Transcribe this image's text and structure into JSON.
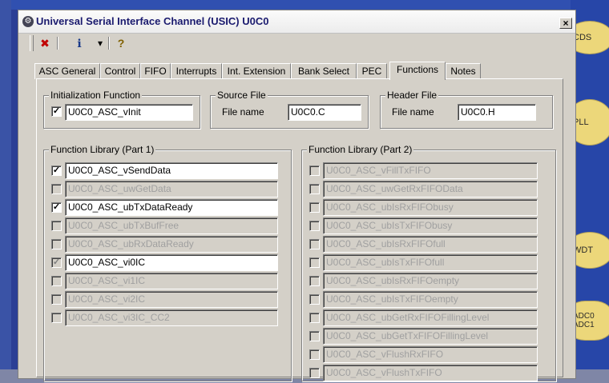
{
  "window": {
    "title": "Universal Serial Interface Channel (USIC) U0C0",
    "close_symbol": "×"
  },
  "toolbar": {
    "buttons": [
      {
        "icon": "close-document-icon",
        "glyph": "✖"
      },
      {
        "icon": "info-book-icon",
        "glyph": "ℹ"
      },
      {
        "icon": "dropdown-arrow-icon",
        "glyph": "▾"
      },
      {
        "icon": "help-icon",
        "glyph": "?"
      }
    ]
  },
  "tabs": [
    {
      "label": "ASC General"
    },
    {
      "label": "Control"
    },
    {
      "label": "FIFO"
    },
    {
      "label": "Interrupts"
    },
    {
      "label": "Int. Extension"
    },
    {
      "label": "Bank Select"
    },
    {
      "label": "PEC"
    },
    {
      "label": "Functions",
      "active": true
    },
    {
      "label": "Notes"
    }
  ],
  "init_group": {
    "label": "Initialization Function",
    "checked": true,
    "check_glyph": "✓",
    "value": "U0C0_ASC_vInit"
  },
  "source_group": {
    "label": "Source File",
    "field_label": "File name",
    "value": "U0C0.C"
  },
  "header_group": {
    "label": "Header File",
    "field_label": "File name",
    "value": "U0C0.H"
  },
  "lib1": {
    "label": "Function Library (Part 1)",
    "items": [
      {
        "name": "U0C0_ASC_vSendData",
        "checked": true,
        "enabled": true
      },
      {
        "name": "U0C0_ASC_uwGetData",
        "checked": false,
        "enabled": false
      },
      {
        "name": "U0C0_ASC_ubTxDataReady",
        "checked": true,
        "enabled": true
      },
      {
        "name": "U0C0_ASC_ubTxBufFree",
        "checked": false,
        "enabled": false
      },
      {
        "name": "U0C0_ASC_ubRxDataReady",
        "checked": false,
        "enabled": false
      },
      {
        "name": "U0C0_ASC_vi0IC",
        "checked": true,
        "enabled": true,
        "checkbox_disabled": true
      },
      {
        "name": "U0C0_ASC_vi1IC",
        "checked": false,
        "enabled": false
      },
      {
        "name": "U0C0_ASC_vi2IC",
        "checked": false,
        "enabled": false
      },
      {
        "name": "U0C0_ASC_vi3IC_CC2",
        "checked": false,
        "enabled": false
      }
    ]
  },
  "lib2": {
    "label": "Function Library (Part 2)",
    "items": [
      {
        "name": "U0C0_ASC_vFillTxFIFO"
      },
      {
        "name": "U0C0_ASC_uwGetRxFIFOData"
      },
      {
        "name": "U0C0_ASC_ubIsRxFIFObusy"
      },
      {
        "name": "U0C0_ASC_ubIsTxFIFObusy"
      },
      {
        "name": "U0C0_ASC_ubIsRxFIFOfull"
      },
      {
        "name": "U0C0_ASC_ubIsTxFIFOfull"
      },
      {
        "name": "U0C0_ASC_ubIsRxFIFOempty"
      },
      {
        "name": "U0C0_ASC_ubIsTxFIFOempty"
      },
      {
        "name": "U0C0_ASC_ubGetRxFIFOFillingLevel"
      },
      {
        "name": "U0C0_ASC_ubGetTxFIFOFillingLevel"
      },
      {
        "name": "U0C0_ASC_vFlushRxFIFO"
      },
      {
        "name": "U0C0_ASC_vFlushTxFIFO"
      }
    ]
  },
  "background_blocks": [
    {
      "label": "CDS"
    },
    {
      "label": "PLL"
    },
    {
      "label": "WDT"
    },
    {
      "label": "ADC0"
    },
    {
      "label": "ADC1"
    }
  ],
  "colors": {
    "title_text": "#1a1a6e",
    "bubble": "#ecd77a",
    "desktop": "#2b3f95"
  }
}
